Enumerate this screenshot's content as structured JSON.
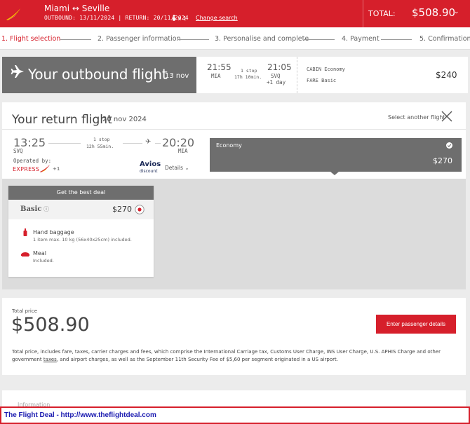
{
  "colors": {
    "brand": "#d61f2b",
    "dark_panel": "#6e6e6e",
    "banner_text": "#1a1ab0"
  },
  "header": {
    "route": "Miami ↔ Seville",
    "outbound_label": "OUTBOUND:",
    "outbound_date": "13/11/2024",
    "return_label": "RETURN:",
    "return_date": "20/11/2024",
    "passengers": "x 1",
    "change_search": "Change search",
    "total_label": "TOTAL:",
    "total_value": "$508.90"
  },
  "steps": [
    {
      "label": "1. Flight selection"
    },
    {
      "label": "2. Passenger information"
    },
    {
      "label": "3. Personalise and complete"
    },
    {
      "label": "4. Payment"
    },
    {
      "label": "5. Confirmation"
    }
  ],
  "outbound": {
    "title": "Your outbound flight",
    "date": "13 nov",
    "dep_time": "21:55",
    "dep_airport": "MIA",
    "stops": "1 stop",
    "duration": "17h 10min.",
    "arr_time": "21:05",
    "arr_airport": "SVQ",
    "day_offset": "+1 day",
    "cabin_label": "CABIN",
    "cabin_value": "Economy",
    "fare_label": "FARE",
    "fare_value": "Basic",
    "price": "$240"
  },
  "return": {
    "title": "Your return flight",
    "date": "20 nov 2024",
    "select_another": "Select another flight",
    "dep_time": "13:25",
    "dep_airport": "SVQ",
    "stops": "1 stop",
    "duration": "12h 55min.",
    "arr_time": "20:20",
    "arr_airport": "MIA",
    "operated_by": "Operated by:",
    "carrier_logo_text": "EXPRESS",
    "carrier_extra": "+1",
    "avios_top": "Avios",
    "avios_bottom": "discount",
    "details": "Details",
    "cabin": "Economy",
    "cabin_price": "$270"
  },
  "deal": {
    "header": "Get the best deal",
    "fare_name": "Basic",
    "price": "$270",
    "features": [
      {
        "icon": "baggage-icon",
        "title": "Hand baggage",
        "detail": "1 item max. 10 kg (56x40x25cm) included."
      },
      {
        "icon": "meal-icon",
        "title": "Meal",
        "detail": "Included."
      }
    ]
  },
  "total": {
    "label": "Total price",
    "value": "$508.90",
    "cta": "Enter passenger details",
    "note_a": "Total price, includes fare, taxes, carrier charges and fees, which comprise the International Carriage tax, Customs User Charge, INS User Charge, U.S. APHIS Charge and other government ",
    "note_link": "taxes",
    "note_b": ", and airport charges, as well as the September 11th Security Fee of $5,60 per segment originated in a US airport."
  },
  "bottom": {
    "peek": "Information"
  },
  "banner": {
    "text": "The Flight Deal - http://www.theflightdeal.com"
  }
}
